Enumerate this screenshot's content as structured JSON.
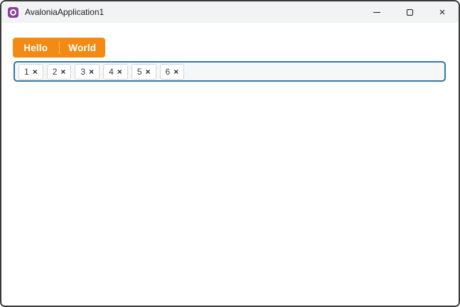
{
  "window": {
    "title": "AvaloniaApplication1",
    "controls": {
      "close_glyph": "×"
    }
  },
  "colors": {
    "tab_accent_orange": "#f28a14",
    "chips_border_blue": "#2e78a8",
    "titlebar_background": "#f2f3f5",
    "logo_purple": "#8b3e9d",
    "window_border": "#3a3a3a"
  },
  "icons": {
    "app_logo": "avalonia-logo-icon",
    "minimize": "minimize-icon",
    "maximize": "maximize-icon",
    "close": "close-icon",
    "chip_remove": "close-icon"
  },
  "tab_strip": {
    "tabs": [
      {
        "label": "Hello"
      },
      {
        "label": "World"
      }
    ]
  },
  "chips_input": {
    "chips": [
      {
        "value": "1",
        "remove_glyph": "×"
      },
      {
        "value": "2",
        "remove_glyph": "×"
      },
      {
        "value": "3",
        "remove_glyph": "×"
      },
      {
        "value": "4",
        "remove_glyph": "×"
      },
      {
        "value": "5",
        "remove_glyph": "×"
      },
      {
        "value": "6",
        "remove_glyph": "×"
      }
    ]
  }
}
